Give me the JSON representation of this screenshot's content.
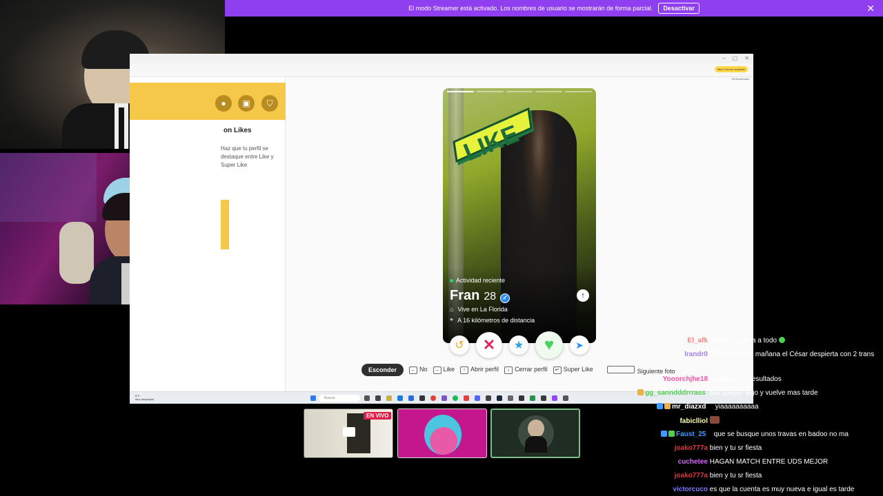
{
  "banner": {
    "text": "El modo Streamer está activado. Los nombres de usuario se mostrarán de forma parcial.",
    "button": "Desactivar",
    "close": "✕"
  },
  "browser": {
    "update_chip": "New Chrome available",
    "bookmarks": "All Bookmarks",
    "window_controls": [
      "–",
      "▢",
      "✕"
    ]
  },
  "sidebar": {
    "heading": "on Likes",
    "subtext": "Haz que tu perfil se destaque entre Like y Super Like"
  },
  "profile": {
    "activity": "Actividad reciente",
    "name": "Fran",
    "age": "28",
    "lives": "Vive en La Florida",
    "distance": "A 16 kilómetros de distancia",
    "stamp": "LIKE"
  },
  "actions": {
    "rewind": "↺",
    "nope": "✕",
    "superlike": "★",
    "like": "♥",
    "boost": "➤"
  },
  "shortcuts": {
    "hide": "Esconder",
    "no": "No",
    "like": "Like",
    "open": "Abrir perfil",
    "close": "Cerrar perfil",
    "superlike": "Super Like",
    "next": "Siguiente foto"
  },
  "taskbar": {
    "search": "Buscar",
    "weather_temp": "8°C",
    "weather_desc": "Muy despejado",
    "time": "",
    "date": ""
  },
  "live": {
    "badge": "EN VIVO"
  },
  "chat": [
    {
      "user": "El_afk",
      "text": "porque le daba a todo",
      "color": "#ff7f7f"
    },
    {
      "user": "lrandr0",
      "text": "tranka nomas, mañana el César despierta con 2 trans",
      "color": "#a77ff2"
    },
    {
      "user": "Yooorchjhe18",
      "text": "mañana hay resultados",
      "color": "#ff4da6"
    },
    {
      "user": "gg_sanndddrrrass",
      "text": "que juegue algo y vuelve mas tarde",
      "color": "#4fd14f"
    },
    {
      "user": "mr_diazxd",
      "text": "yiaaaaaaaaaa",
      "color": "#ffffff"
    },
    {
      "user": "fabiclliol",
      "text": "",
      "color": "#ffffaa"
    },
    {
      "user": "Faust_25",
      "text": "que se busque unos travas en badoo no ma",
      "color": "#3f9bff"
    },
    {
      "user": "joako777a",
      "text": "bien y tu sr fiesta",
      "color": "#e03a3a"
    },
    {
      "user": "cuchetee",
      "text": "HAGAN MATCH ENTRE UDS MEJOR",
      "color": "#d766ff"
    },
    {
      "user": "joako777a",
      "text": "bien y tu sr fiesta",
      "color": "#e03a3a"
    },
    {
      "user": "victorcuco",
      "text": "es que la cuenta es muy nueva e igual es tarde",
      "color": "#7b7bff"
    }
  ]
}
